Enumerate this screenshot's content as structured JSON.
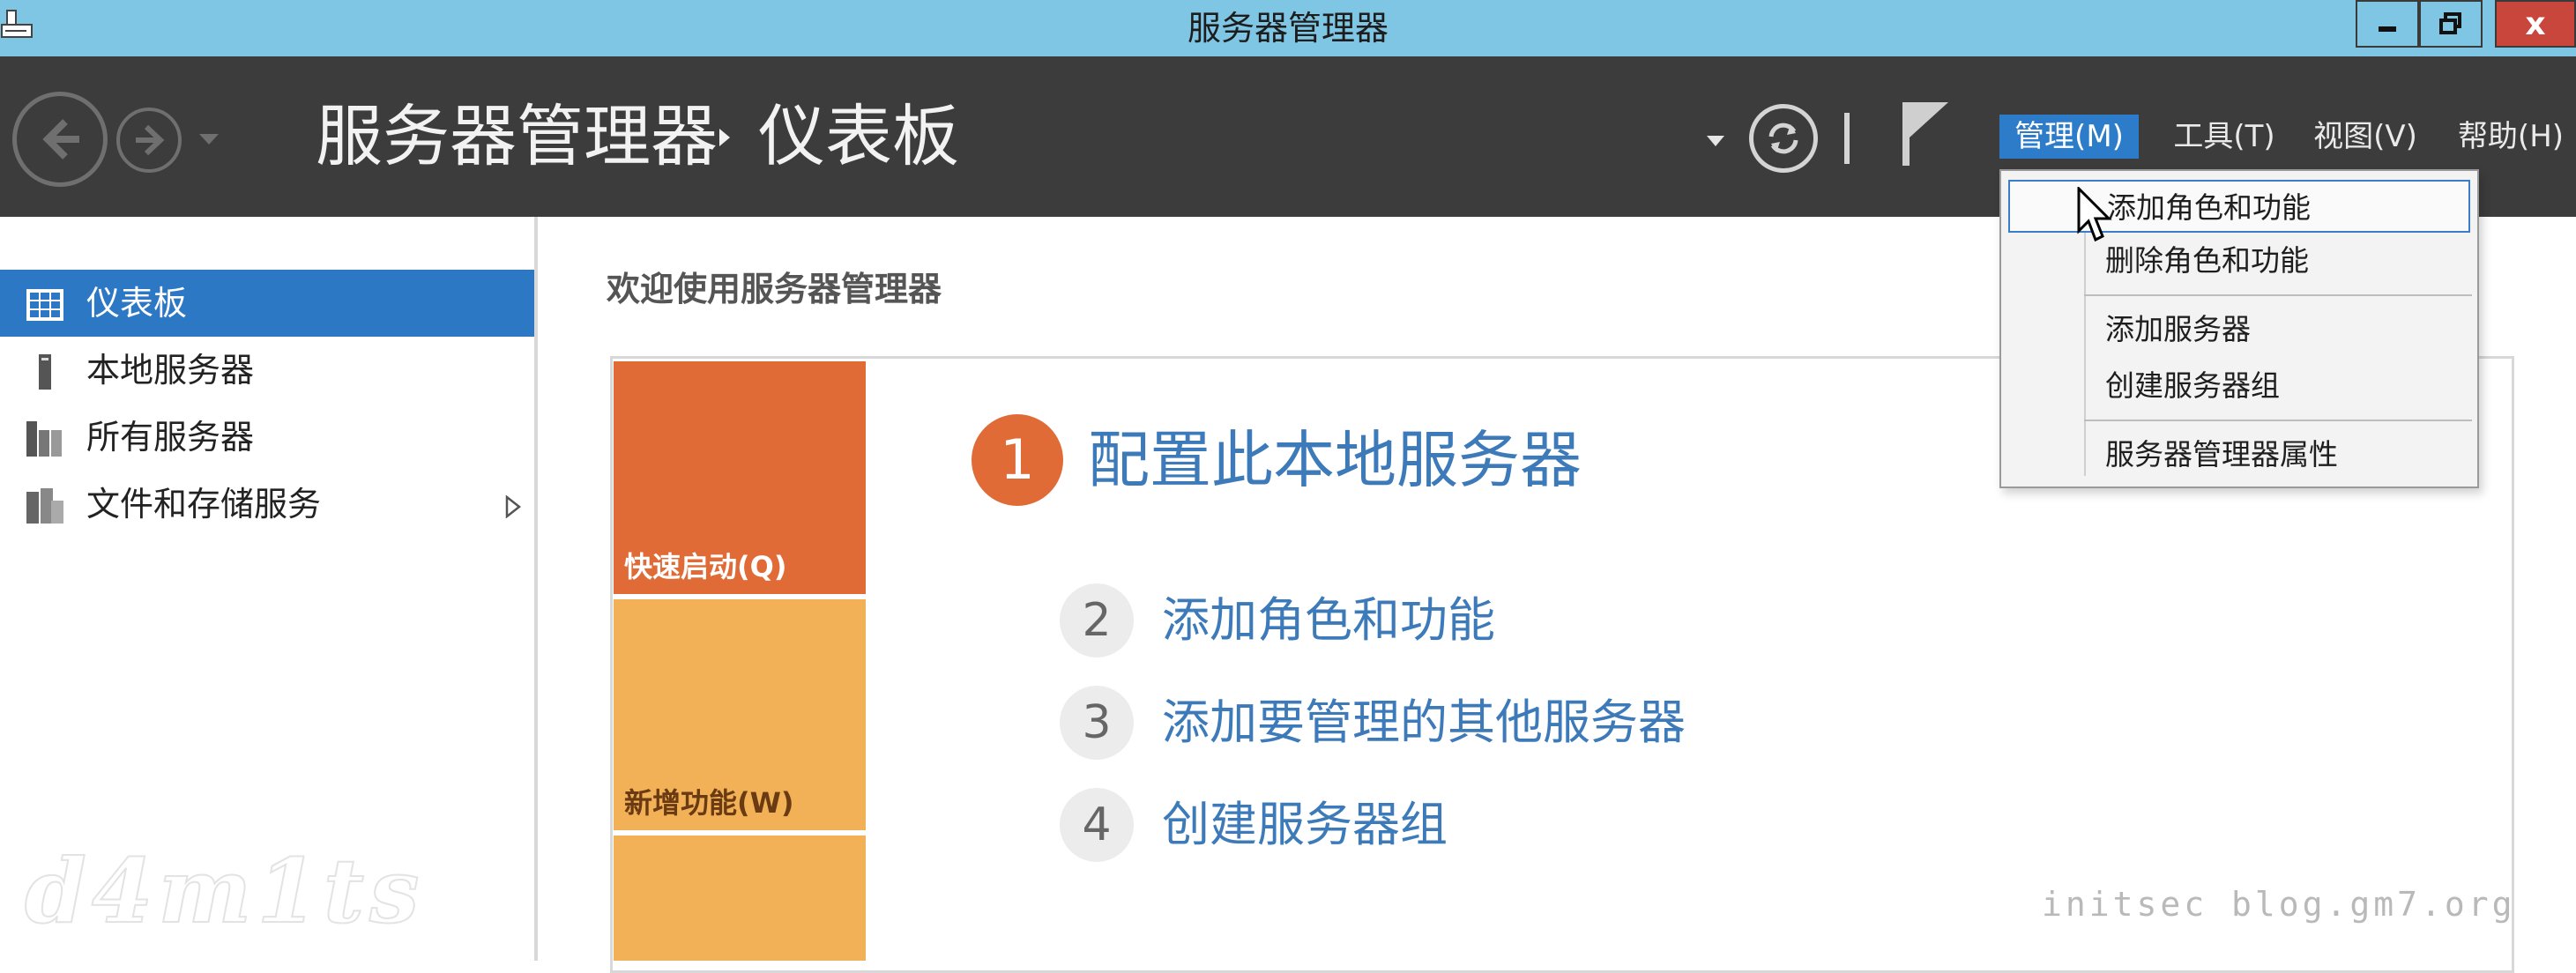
{
  "titlebar": {
    "title": "服务器管理器",
    "icons": {
      "app": "server-manager-app-icon",
      "minimize": "minimize-icon",
      "maximize": "restore-icon",
      "close": "close-icon"
    },
    "close_label": "x"
  },
  "nav": {
    "breadcrumb_root": "服务器管理器",
    "breadcrumb_current": "仪表板",
    "icons": {
      "back": "back-arrow-icon",
      "forward": "forward-arrow-icon",
      "history": "chevron-down-icon",
      "refresh": "refresh-icon",
      "notifications": "flag-icon"
    }
  },
  "menu": {
    "manage": "管理(M)",
    "tools": "工具(T)",
    "view": "视图(V)",
    "help": "帮助(H)"
  },
  "manage_dropdown": {
    "items": [
      {
        "label": "添加角色和功能"
      },
      {
        "label": "删除角色和功能"
      },
      {
        "label": "添加服务器"
      },
      {
        "label": "创建服务器组"
      },
      {
        "label": "服务器管理器属性"
      }
    ]
  },
  "sidebar": {
    "items": [
      {
        "label": "仪表板",
        "icon": "dashboard-grid-icon",
        "selected": true
      },
      {
        "label": "本地服务器",
        "icon": "local-server-icon"
      },
      {
        "label": "所有服务器",
        "icon": "all-servers-icon"
      },
      {
        "label": "文件和存储服务",
        "icon": "file-storage-icon",
        "expandable": true
      }
    ]
  },
  "main": {
    "welcome_title": "欢迎使用服务器管理器",
    "tiles": [
      {
        "label": "快速启动(Q)",
        "color": "#e06b37"
      },
      {
        "label": "新增功能(W)",
        "color": "#f2b157"
      },
      {
        "label": "",
        "color": "#f2b157"
      }
    ],
    "steps": [
      {
        "number": "1",
        "label": "配置此本地服务器"
      },
      {
        "number": "2",
        "label": "添加角色和功能"
      },
      {
        "number": "3",
        "label": "添加要管理的其他服务器"
      },
      {
        "number": "4",
        "label": "创建服务器组"
      }
    ]
  },
  "watermarks": {
    "left_logo": "d4m1ts",
    "right_text": "initsec blog.gm7.org"
  },
  "colors": {
    "titlebar": "#7fc6e4",
    "navbar": "#3c3c3c",
    "accent": "#2d78c4",
    "quickstart_tile": "#e06b37",
    "secondary_tile": "#f2b157",
    "link": "#3d7ab9"
  }
}
